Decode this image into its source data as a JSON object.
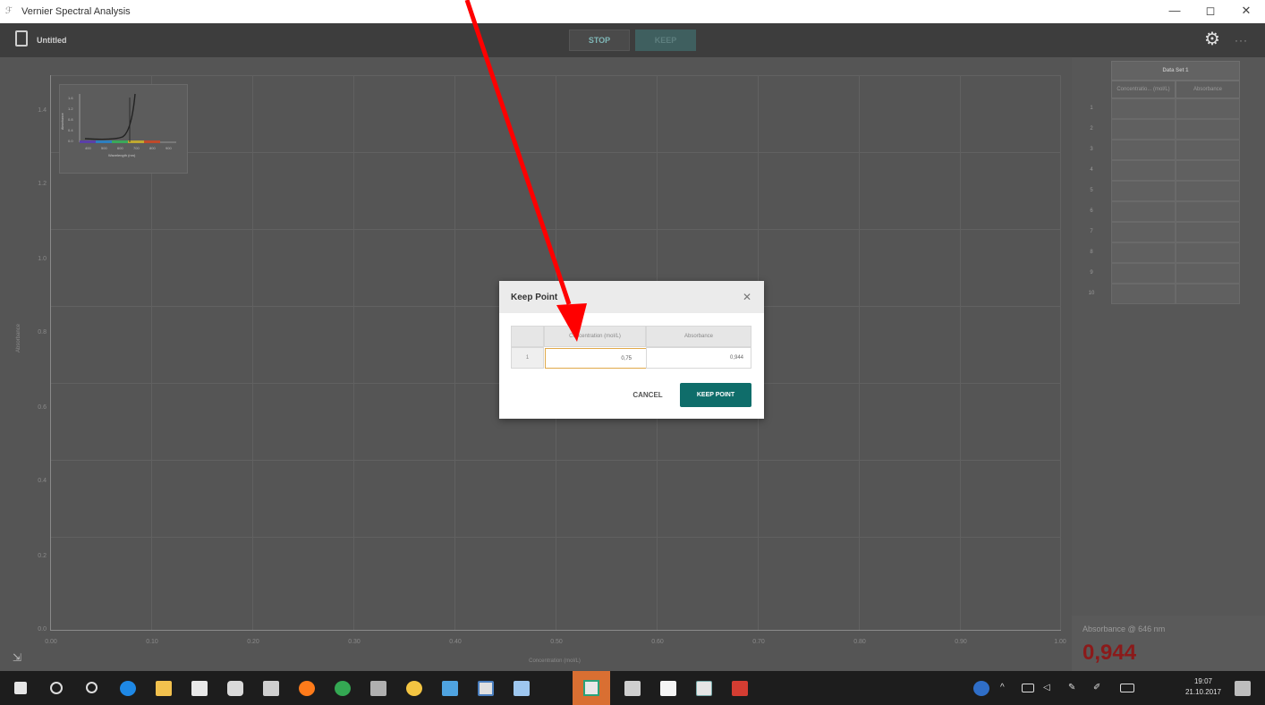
{
  "window": {
    "title": "Vernier Spectral Analysis",
    "controls": [
      "—",
      "◻",
      "✕"
    ]
  },
  "toolbar": {
    "doc_title": "Untitled",
    "stop_label": "STOP",
    "keep_label": "KEEP",
    "file_icon": "file-icon",
    "settings_icon": "gear-icon",
    "more_label": "···"
  },
  "graph": {
    "y_ticks": [
      "1.4",
      "1.2",
      "1.0",
      "0.8",
      "0.6",
      "0.4",
      "0.2",
      "0.0"
    ],
    "x_ticks": [
      "0.00",
      "0.10",
      "0.20",
      "0.30",
      "0.40",
      "0.50",
      "0.60",
      "0.70",
      "0.80",
      "0.90",
      "1.00"
    ],
    "y_label": "Absorbance",
    "x_label": "Concentration (mol/L)",
    "corner_icon": "axis-options-icon",
    "thumbnail": {
      "y_ticks": [
        "1.6",
        "1.2",
        "0.8",
        "0.4",
        "0.0"
      ],
      "x_ticks": [
        "400",
        "500",
        "600",
        "700",
        "800",
        "900"
      ],
      "x_label": "Wavelength (nm)",
      "y_label": "Absorbance"
    }
  },
  "data_table": {
    "title": "Data Set 1",
    "col1": "Concentratio... (mol/L)",
    "col2": "Absorbance",
    "rows": [
      "1",
      "2",
      "3",
      "4",
      "5",
      "6",
      "7",
      "8",
      "9",
      "10"
    ]
  },
  "readout": {
    "label": "Absorbance @ 646 nm",
    "value": "0,944"
  },
  "modal": {
    "title": "Keep Point",
    "close_icon": "close-icon",
    "col_conc": "Concentration (mol/L)",
    "col_abs": "Absorbance",
    "row_index": "1",
    "conc_value": "0,75",
    "abs_value": "0,944",
    "cancel_label": "CANCEL",
    "keep_label": "KEEP POINT"
  },
  "taskbar": {
    "time": "19:07",
    "date": "21.10.2017",
    "accent": "#d96f32"
  },
  "colors": {
    "teal": "#0f6d6a",
    "readout_red": "#8b1a1a",
    "annotation_arrow": "#ff0000"
  }
}
